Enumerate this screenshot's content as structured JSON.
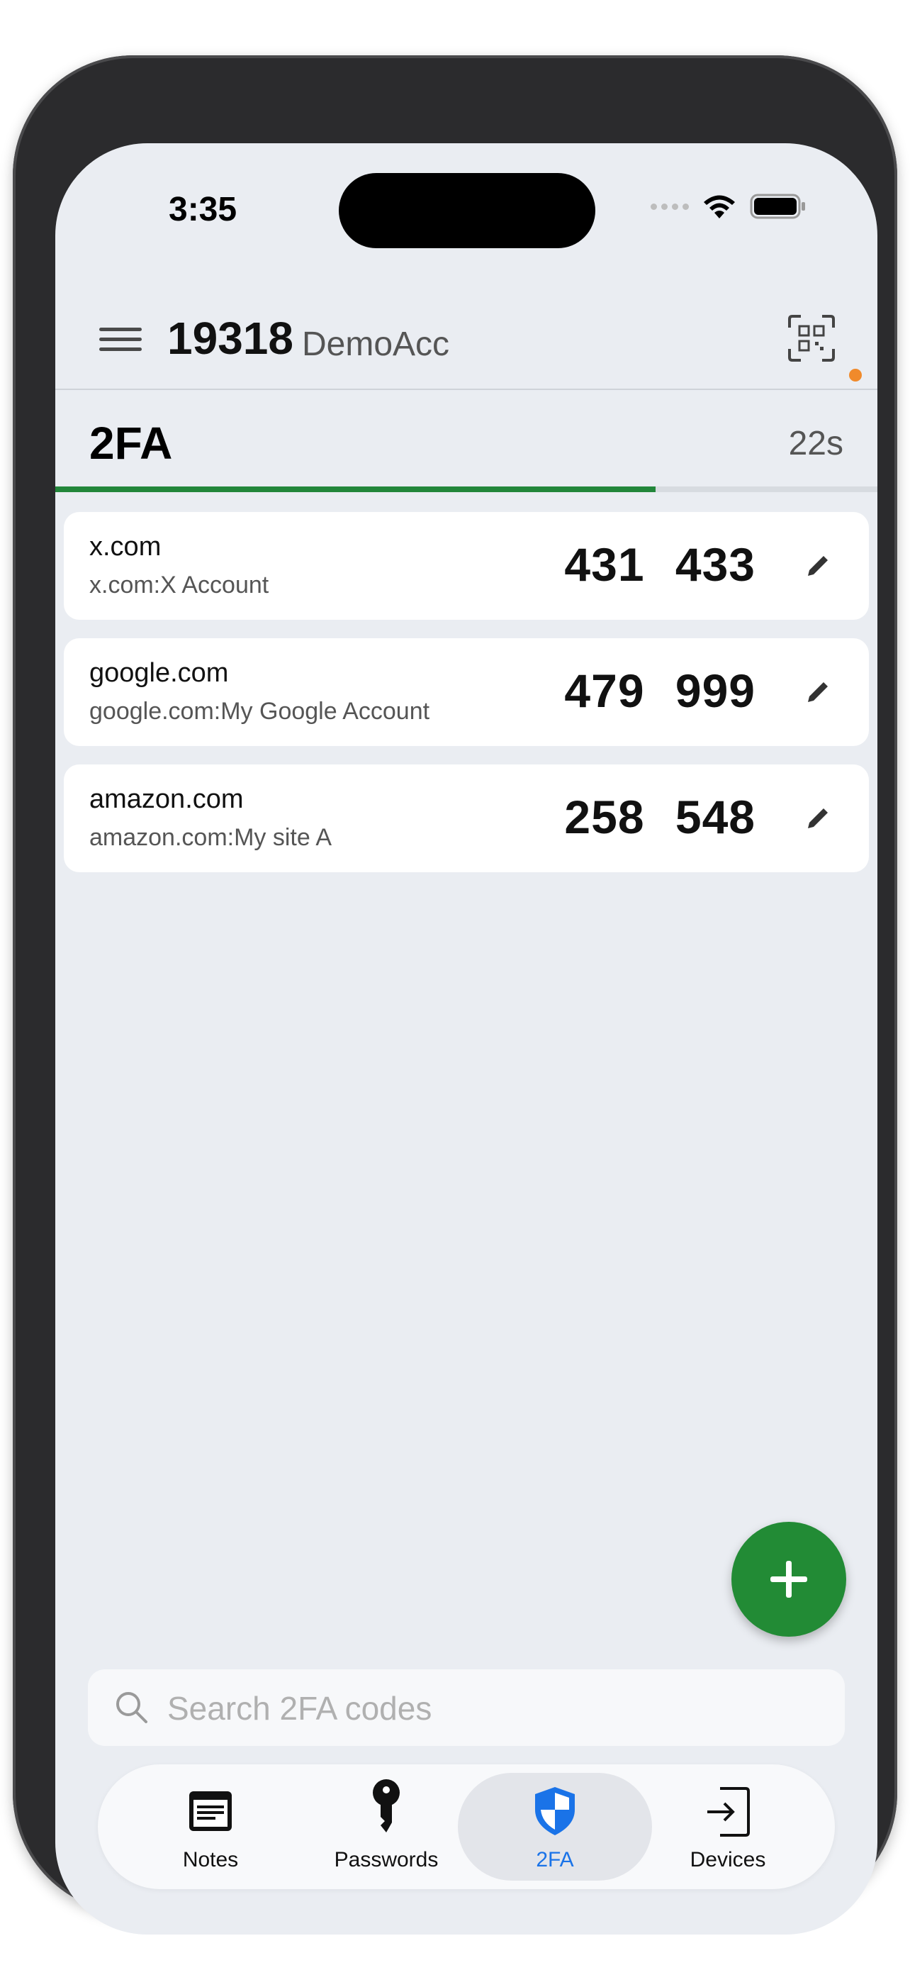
{
  "status_bar": {
    "time": "3:35"
  },
  "header": {
    "account_number": "19318",
    "account_name": "DemoAcc"
  },
  "section": {
    "title": "2FA",
    "timer": "22s",
    "progress_fraction": 0.73
  },
  "entries": [
    {
      "site": "x.com",
      "label": "x.com:X Account",
      "code": "431 433"
    },
    {
      "site": "google.com",
      "label": "google.com:My Google Account",
      "code": "479 999"
    },
    {
      "site": "amazon.com",
      "label": "amazon.com:My site A",
      "code": "258 548"
    }
  ],
  "search": {
    "placeholder": "Search 2FA codes"
  },
  "tabs": [
    {
      "label": "Notes",
      "icon": "notes-icon"
    },
    {
      "label": "Passwords",
      "icon": "key-icon"
    },
    {
      "label": "2FA",
      "icon": "shield-icon",
      "active": true
    },
    {
      "label": "Devices",
      "icon": "login-icon"
    }
  ],
  "colors": {
    "accent_green": "#228b35",
    "active_blue": "#1a73e8",
    "notification": "#f08a2b"
  }
}
